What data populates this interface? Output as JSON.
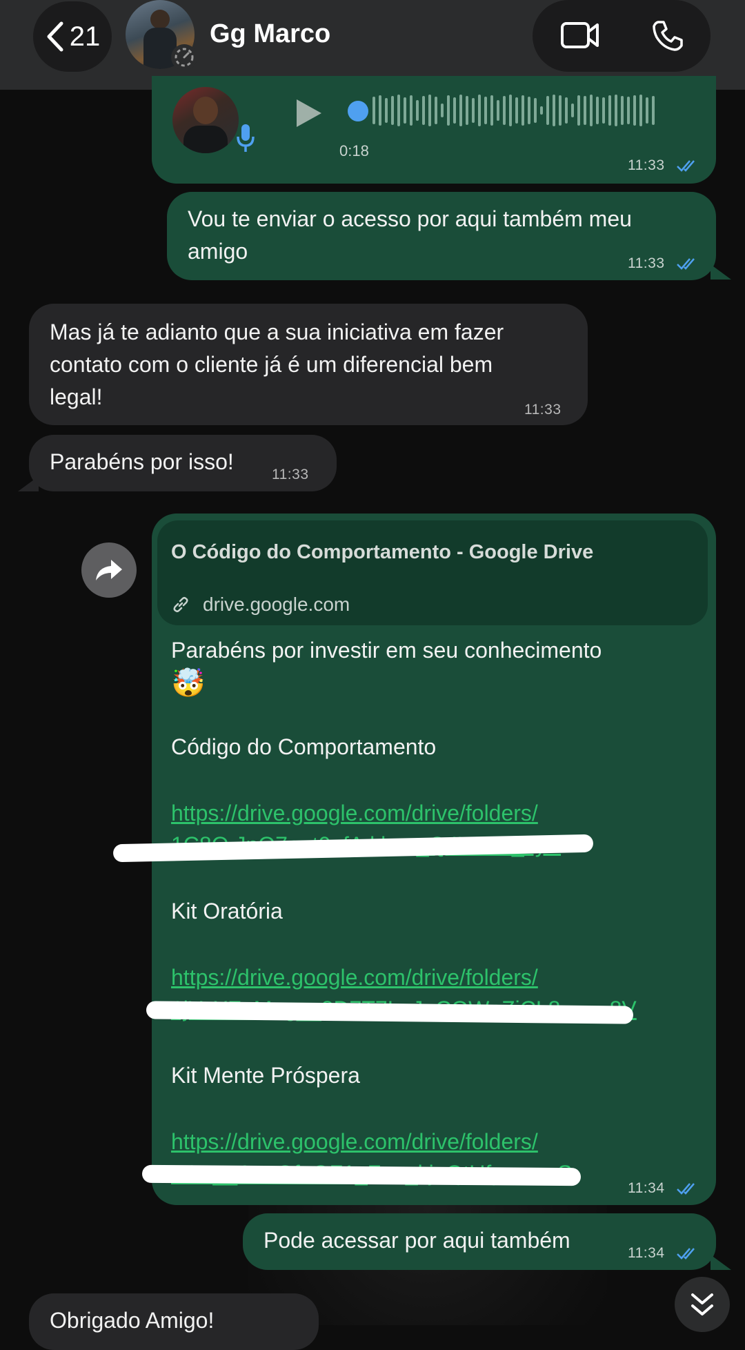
{
  "header": {
    "back_count": "21",
    "contact_name": "Gg Marco"
  },
  "messages": {
    "voice": {
      "duration": "0:18",
      "time": "11:33"
    },
    "m1": {
      "text_line1": "Vou te enviar o acesso por aqui também meu",
      "text_line2": "amigo",
      "time": "11:33"
    },
    "m2": {
      "line1": "Mas já te adianto que a sua iniciativa em fazer",
      "line2": "contato com o cliente já é um diferencial bem",
      "line3": "legal!",
      "time": "11:33"
    },
    "m3": {
      "text": "Parabéns por isso!",
      "time": "11:33"
    },
    "m4": {
      "preview_title": "O Código do Comportamento  - Google Drive",
      "preview_domain": "drive.google.com",
      "intro": "Parabéns por investir em seu conhecimento",
      "emoji": "🤯",
      "item1_title": "Código do Comportamento",
      "item1_url": "https://drive.google.com/drive/folders/",
      "item1_url_tail": "1C8Q.JnQ7eet0_fA.klum_Q4YD11_cyE",
      "item2_title": "Kit Oratória",
      "item2_url": "https://drive.google.com/drive/folders/",
      "item2_url_tail": "1jYoXZuMeg__8D7T7L_JeCOWnZiCL8____8V",
      "item3_title": "Kit Mente Próspera",
      "item3_url": "https://drive.google.com/drive/folders/",
      "item3_url_tail": "1Oa__AuoOfaOF1_Fan_kjuQtUfpmo_yS",
      "time": "11:34"
    },
    "m5": {
      "text": "Pode acessar por aqui também",
      "time": "11:34"
    },
    "m6": {
      "text": "Obrigado Amigo!"
    }
  },
  "icons": {
    "back": "chevron-left-icon",
    "video": "video-call-icon",
    "phone": "phone-icon",
    "play": "play-icon",
    "mic": "microphone-icon",
    "link": "link-icon",
    "forward": "forward-icon",
    "scroll": "double-chevron-down-icon",
    "read": "double-check-icon"
  },
  "colors": {
    "outgoing_bubble": "#1a4d39",
    "incoming_bubble": "#262628",
    "link": "#2dc26b",
    "read_ticks": "#4fa0f0"
  }
}
